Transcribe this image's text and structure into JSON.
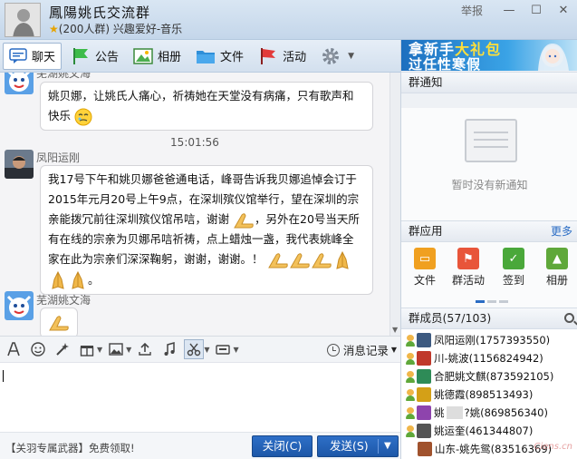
{
  "window": {
    "title": "鳳陽姚氏交流群",
    "subtitle": "(200人群) 兴趣爱好-音乐",
    "report_label": "举报",
    "minimize_glyph": "—",
    "maximize_glyph": "☐",
    "close_glyph": "✕"
  },
  "toolbar": {
    "tabs": [
      {
        "label": "聊天",
        "icon": "chat-icon"
      },
      {
        "label": "公告",
        "icon": "announcement-flag-icon"
      },
      {
        "label": "相册",
        "icon": "photo-album-icon"
      },
      {
        "label": "文件",
        "icon": "folder-icon"
      },
      {
        "label": "活动",
        "icon": "activity-flag-icon"
      }
    ],
    "settings_icon": "gear-icon"
  },
  "chat": {
    "messages": [
      {
        "sender": "芜湖姚文海",
        "lines": [
          "姚贝娜，让姚氏人痛心，祈祷她在天堂没有病痛，只有歌声和",
          "快乐"
        ]
      },
      {
        "sender": "凤阳运刚",
        "lines": [
          "我17号下午和姚贝娜爸爸通电话，峰哥告诉我贝娜追悼会订于",
          "2015年元月20号上午9点，在深圳殡仪馆举行，望在深圳的宗",
          "亲能拨冗前往深圳殡仪馆吊唁，谢谢",
          "，另外在20号当天所",
          "有在线的宗亲为贝娜吊唁祈祷，点上蜡烛一盏，我代表姚峰全",
          "家在此为宗亲们深深鞠躬，谢谢，谢谢。！",
          "。"
        ]
      },
      {
        "sender": "芜湖姚文海",
        "lines": []
      }
    ],
    "timestamp": "15:01:56"
  },
  "input": {
    "history_label": "消息记录",
    "close_label": "关闭(C)",
    "send_label": "发送(S)",
    "promo_text": "【关羽专属武器】免费领取!"
  },
  "right_panel": {
    "ad_line1": "拿新手",
    "ad_line1_hl": "大礼包",
    "ad_line2": "过任性寒假",
    "notice_title": "群通知",
    "notice_empty": "暂时没有新通知",
    "apps_title": "群应用",
    "apps_more": "更多",
    "apps": [
      {
        "label": "文件",
        "color": "#f0a020",
        "glyph": "▭"
      },
      {
        "label": "群活动",
        "color": "#e8553a",
        "glyph": "⚑"
      },
      {
        "label": "签到",
        "color": "#4aa83a",
        "glyph": "✓"
      },
      {
        "label": "相册",
        "color": "#5fa83a",
        "glyph": "▲"
      }
    ],
    "members_title": "群成员(57/103)",
    "members": [
      {
        "name": "凤阳运刚(1757393550)",
        "color": "#3d5a80"
      },
      {
        "name": "川-姚波(1156824942)",
        "color": "#c0392b"
      },
      {
        "name": "合肥姚文麒(873592105)",
        "color": "#2e8b57"
      },
      {
        "name": "姚德霞(898513493)",
        "color": "#d4a017"
      },
      {
        "name": "姚",
        "name2": "?姚(869856340)",
        "color": "#8e44ad"
      },
      {
        "name": "姚运奎(461344807)",
        "color": "#555555"
      },
      {
        "name": "山东-姚先鸳(83516369)",
        "color": "#a0522d"
      }
    ],
    "watermark": "Ciens.cn"
  }
}
